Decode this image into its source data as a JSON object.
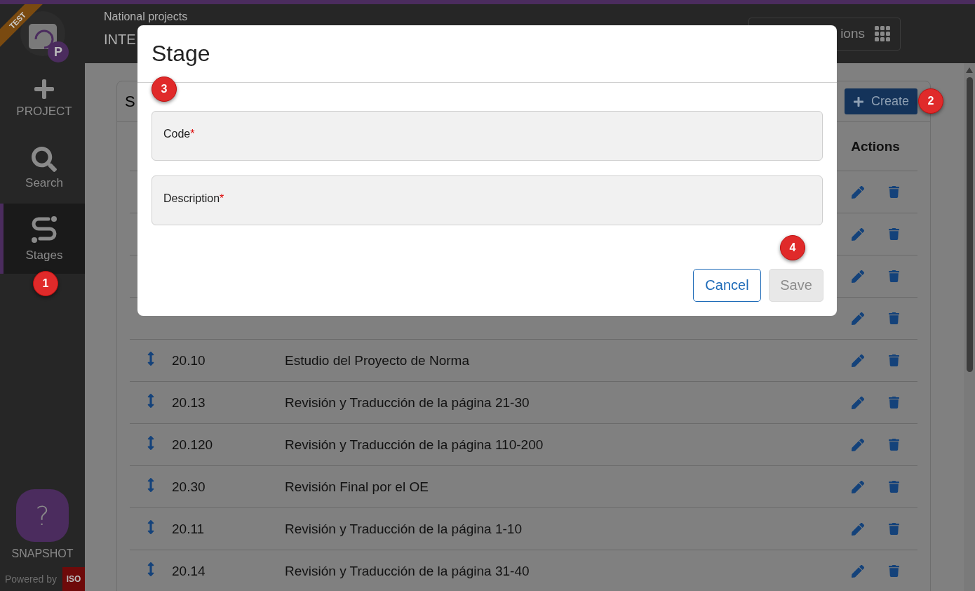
{
  "header": {
    "section": "National projects",
    "title": "INTE",
    "apps_button": "ions"
  },
  "sidebar": {
    "ribbon": "TEST",
    "logo_badge": "P",
    "items": [
      {
        "kind": "add",
        "label": "PROJECT",
        "selected": false
      },
      {
        "kind": "search",
        "label": "Search",
        "selected": false
      },
      {
        "kind": "stages",
        "label": "Stages",
        "selected": true
      }
    ],
    "help": {
      "icon": "?",
      "label": "SNAPSHOT"
    },
    "powered_by": "Powered by",
    "powered_logo": "ISO"
  },
  "card": {
    "title": "S",
    "create_button": "Create",
    "actions_header": "Actions",
    "rows": [
      {
        "kind": "covered"
      },
      {
        "kind": "covered"
      },
      {
        "kind": "covered"
      },
      {
        "kind": "covered"
      },
      {
        "kind": "row",
        "code": "20.10",
        "description": "Estudio del Proyecto de Norma"
      },
      {
        "kind": "row",
        "code": "20.13",
        "description": "Revisión y Traducción de la página 21-30"
      },
      {
        "kind": "row",
        "code": "20.120",
        "description": "Revisión y Traducción de la página 110-200"
      },
      {
        "kind": "row",
        "code": "20.30",
        "description": "Revisión Final por el OE"
      },
      {
        "kind": "row",
        "code": "20.11",
        "description": "Revisión y Traducción de la página 1-10"
      },
      {
        "kind": "row",
        "code": "20.14",
        "description": "Revisión y Traducción de la página 31-40"
      }
    ]
  },
  "dialog": {
    "title": "Stage",
    "fields": [
      {
        "label": "Code",
        "required_mark": "*"
      },
      {
        "label": "Description",
        "required_mark": "*"
      }
    ],
    "buttons": [
      {
        "kind": "outline",
        "label": "Cancel",
        "disabled": false
      },
      {
        "kind": "primary",
        "label": "Save",
        "disabled": true
      }
    ]
  },
  "callouts": [
    "1",
    "2",
    "3",
    "4"
  ]
}
